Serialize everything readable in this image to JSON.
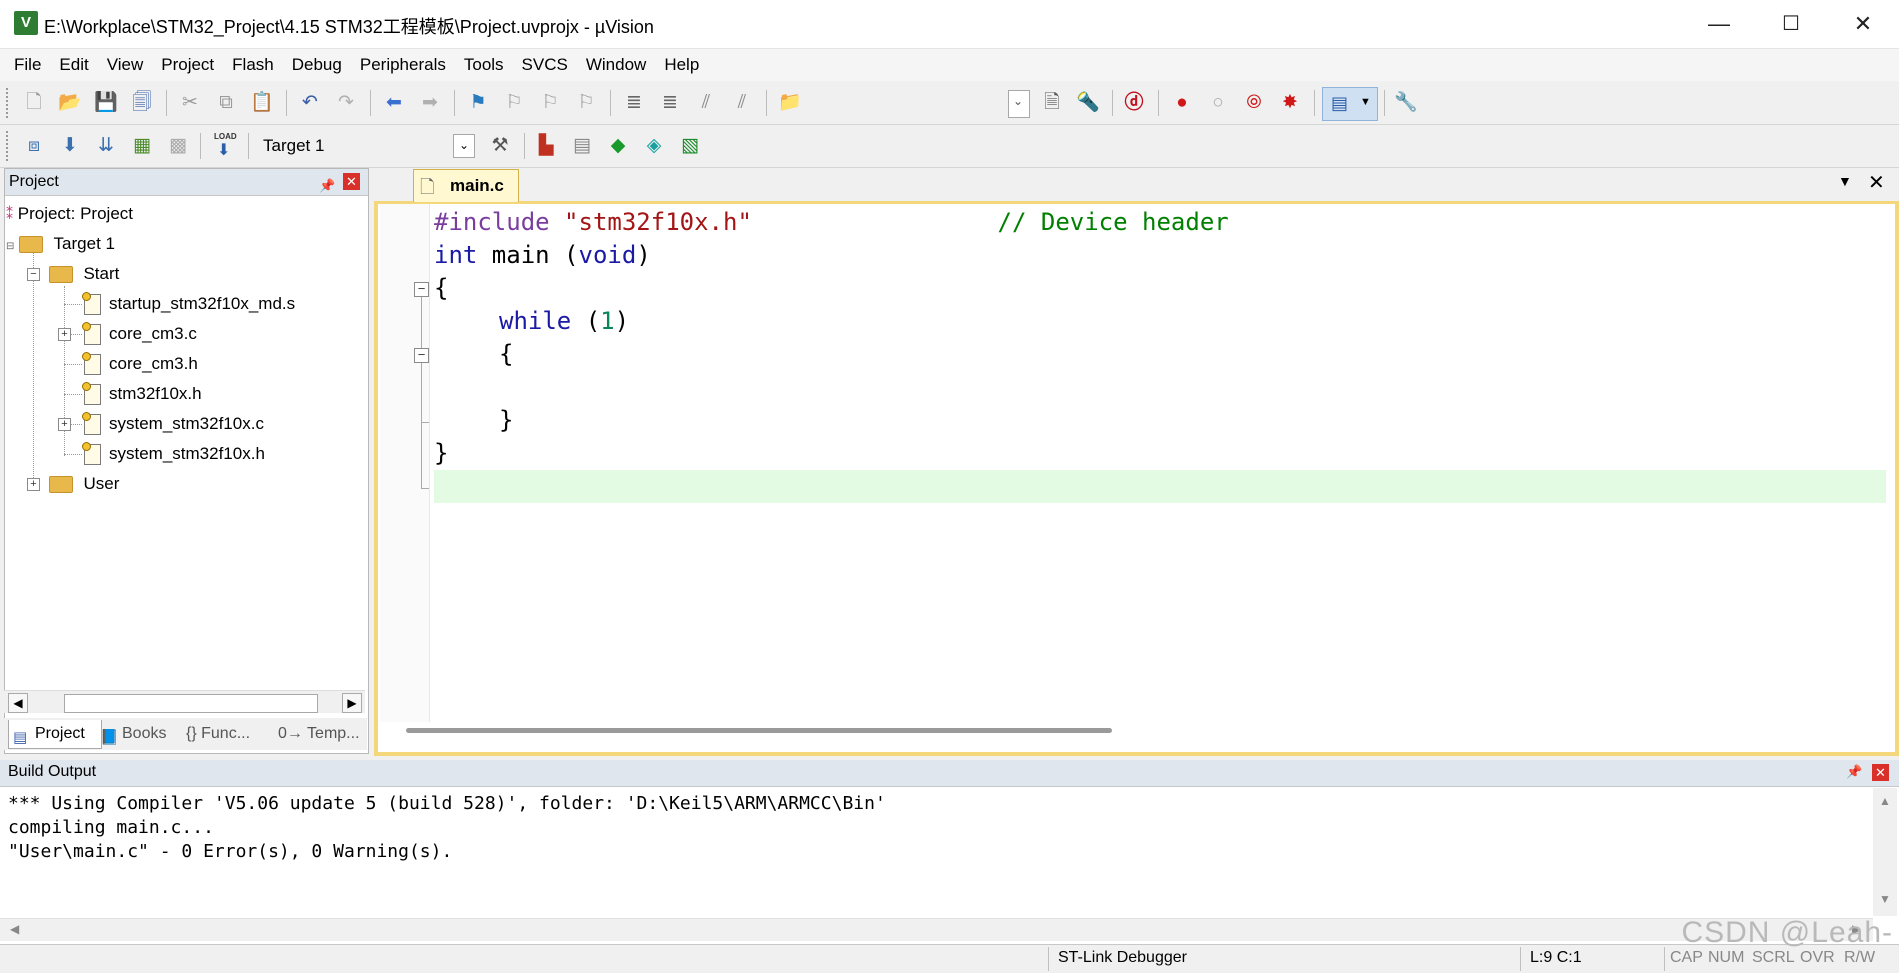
{
  "window": {
    "title": "E:\\Workplace\\STM32_Project\\4.15 STM32工程模板\\Project.uvprojx - µVision",
    "app_icon_letter": "V",
    "minimize": "—",
    "maximize": "☐",
    "close": "✕"
  },
  "menu": [
    "File",
    "Edit",
    "View",
    "Project",
    "Flash",
    "Debug",
    "Peripherals",
    "Tools",
    "SVCS",
    "Window",
    "Help"
  ],
  "toolbar2": {
    "load_label": "LOAD",
    "target_select": "Target 1"
  },
  "project_panel": {
    "title": "Project",
    "tree": {
      "root": "Project: Project",
      "target": "Target 1",
      "group_start": "Start",
      "files": [
        "startup_stm32f10x_md.s",
        "core_cm3.c",
        "core_cm3.h",
        "stm32f10x.h",
        "system_stm32f10x.c",
        "system_stm32f10x.h"
      ],
      "group_user": "User"
    },
    "tabs": [
      "Project",
      "Books",
      "{} Func...",
      "0→ Temp..."
    ]
  },
  "editor": {
    "tab_label": "main.c",
    "code": {
      "l1_pp": "#include ",
      "l1_str": "\"stm32f10x.h\"",
      "l1_pad": "                 ",
      "l1_cmt": "// Device header",
      "l2_kw1": "int",
      "l2_mid": " main (",
      "l2_kw2": "void",
      "l2_end": ")",
      "l3": "{",
      "l4_kw": "while",
      "l4_open": " (",
      "l4_num": "1",
      "l4_close": ")",
      "l5": "{",
      "l6": "",
      "l7": "}",
      "l8": "}"
    }
  },
  "build_output": {
    "title": "Build Output",
    "lines": [
      "*** Using Compiler 'V5.06 update 5 (build 528)', folder: 'D:\\Keil5\\ARM\\ARMCC\\Bin'",
      "compiling main.c...",
      "\"User\\main.c\" - 0 Error(s), 0 Warning(s)."
    ]
  },
  "status": {
    "debugger": "ST-Link Debugger",
    "position": "L:9 C:1",
    "cap": "CAP",
    "num": "NUM",
    "scrl": "SCRL",
    "ovr": "OVR",
    "rw": "R/W"
  },
  "watermark": "CSDN @Leah-"
}
